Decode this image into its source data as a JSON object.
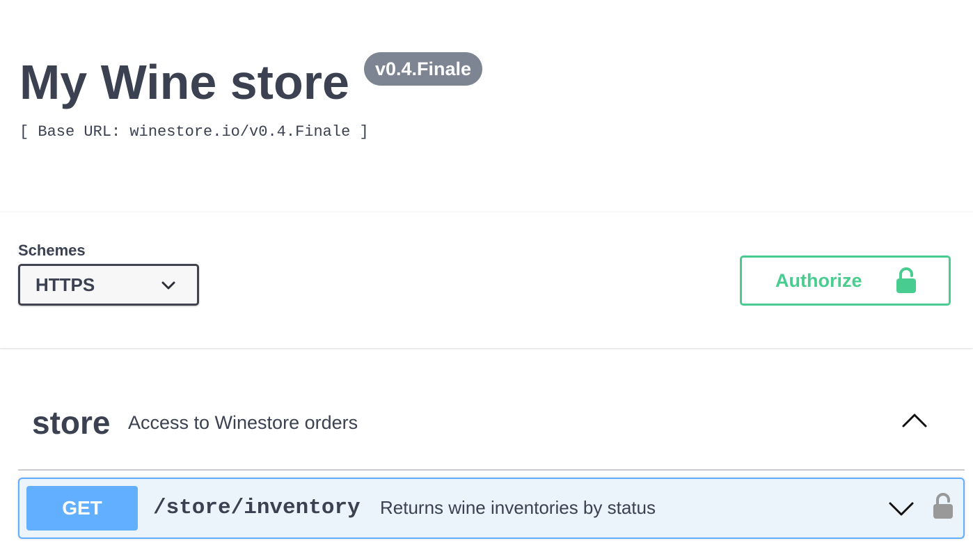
{
  "info": {
    "title": "My Wine store",
    "version": "v0.4.Finale",
    "base_url": "[ Base URL: winestore.io/v0.4.Finale ]"
  },
  "schemes": {
    "label": "Schemes",
    "selected": "HTTPS"
  },
  "authorize": {
    "label": "Authorize"
  },
  "tags": [
    {
      "name": "store",
      "description": "Access to Winestore orders",
      "operations": [
        {
          "method": "GET",
          "path": "/store/inventory",
          "summary": "Returns wine inventories by status"
        }
      ]
    }
  ],
  "colors": {
    "get_accent": "#61affe",
    "get_background": "#ebf3fb",
    "authorize_green": "#49cc90",
    "version_badge": "#7d8492",
    "text": "#3b4151",
    "lock_gray": "#999999"
  },
  "icons": {
    "select_chevron": "chevron-down-icon",
    "authorize_lock": "unlocked-lock-icon",
    "tag_toggle": "chevron-up-icon",
    "op_chevron": "chevron-down-icon",
    "op_lock": "unlocked-lock-icon"
  }
}
